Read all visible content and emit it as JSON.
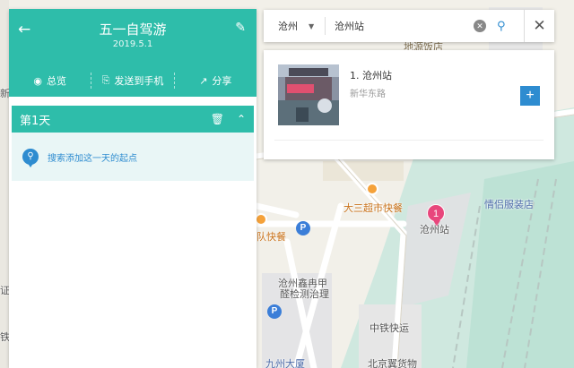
{
  "map": {
    "labels": {
      "top_building": "地源饭店",
      "food_court": "大三超市快餐",
      "fast_food": "队快餐",
      "station": "沧州站",
      "clothing": "情侣服装店",
      "bldg_left_1": "沧州鑫冉甲",
      "bldg_left_2": "醛检测治理",
      "express": "中铁快运",
      "cargo": "北京翼货物",
      "hotel": "九州大厦",
      "edge_1": "新",
      "edge_2": "证",
      "edge_3": "铁"
    },
    "marker_number": "1",
    "parking_label": "P"
  },
  "panel": {
    "title": "五一自驾游",
    "date": "2019.5.1",
    "actions": [
      {
        "label": "总览",
        "icon": "overview-icon"
      },
      {
        "label": "发送到手机",
        "icon": "send-phone-icon"
      },
      {
        "label": "分享",
        "icon": "share-icon"
      }
    ],
    "day": {
      "label": "第1天"
    },
    "add_start_text": "搜索添加这一天的起点"
  },
  "search": {
    "city": "沧州",
    "query": "沧州站"
  },
  "results": [
    {
      "name": "1. 沧州站",
      "address": "新华东路"
    }
  ],
  "colors": {
    "accent": "#2ebdaa",
    "blue": "#2e8cd0",
    "marker": "#e8467c"
  }
}
